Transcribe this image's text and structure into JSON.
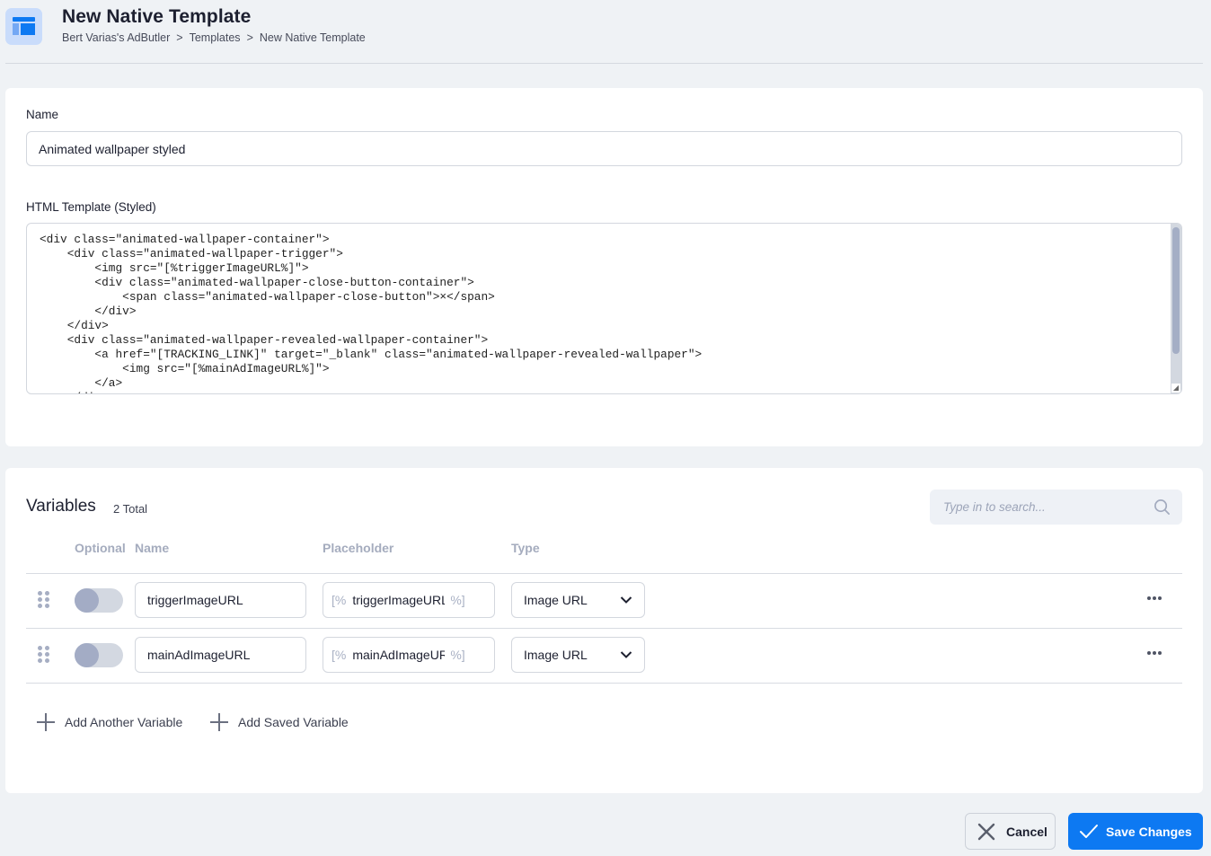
{
  "header": {
    "title": "New Native Template",
    "breadcrumb": [
      "Bert Varias's AdButler",
      "Templates",
      "New Native Template"
    ],
    "breadcrumb_separator": ">",
    "icon": "template-layout-icon"
  },
  "form": {
    "name_label": "Name",
    "name_value": "Animated wallpaper styled",
    "html_label": "HTML Template (Styled)",
    "html_value": "<div class=\"animated-wallpaper-container\">\n    <div class=\"animated-wallpaper-trigger\">\n        <img src=\"[%triggerImageURL%]\">\n        <div class=\"animated-wallpaper-close-button-container\">\n            <span class=\"animated-wallpaper-close-button\">×</span>\n        </div>\n    </div>\n    <div class=\"animated-wallpaper-revealed-wallpaper-container\">\n        <a href=\"[TRACKING_LINK]\" target=\"_blank\" class=\"animated-wallpaper-revealed-wallpaper\">\n            <img src=\"[%mainAdImageURL%]\">\n        </a>\n    </div>"
  },
  "variables": {
    "title": "Variables",
    "total": "2 Total",
    "search_placeholder": "Type in to search...",
    "columns": [
      "Optional",
      "Name",
      "Placeholder",
      "Type"
    ],
    "rows": [
      {
        "optional": false,
        "name": "triggerImageURL",
        "placeholder_open": "[%",
        "placeholder": "triggerImageURL",
        "placeholder_close": "%]",
        "type": "Image URL"
      },
      {
        "optional": false,
        "name": "mainAdImageURL",
        "placeholder_open": "[%",
        "placeholder": "mainAdImageURL",
        "placeholder_close": "%]",
        "type": "Image URL"
      }
    ],
    "add_another_label": "Add Another Variable",
    "add_saved_label": "Add Saved Variable"
  },
  "footer": {
    "cancel_label": "Cancel",
    "save_label": "Save Changes"
  },
  "colors": {
    "accent": "#0d79f2",
    "background": "#eff2f5",
    "toggle_off": "#a3acc5"
  }
}
